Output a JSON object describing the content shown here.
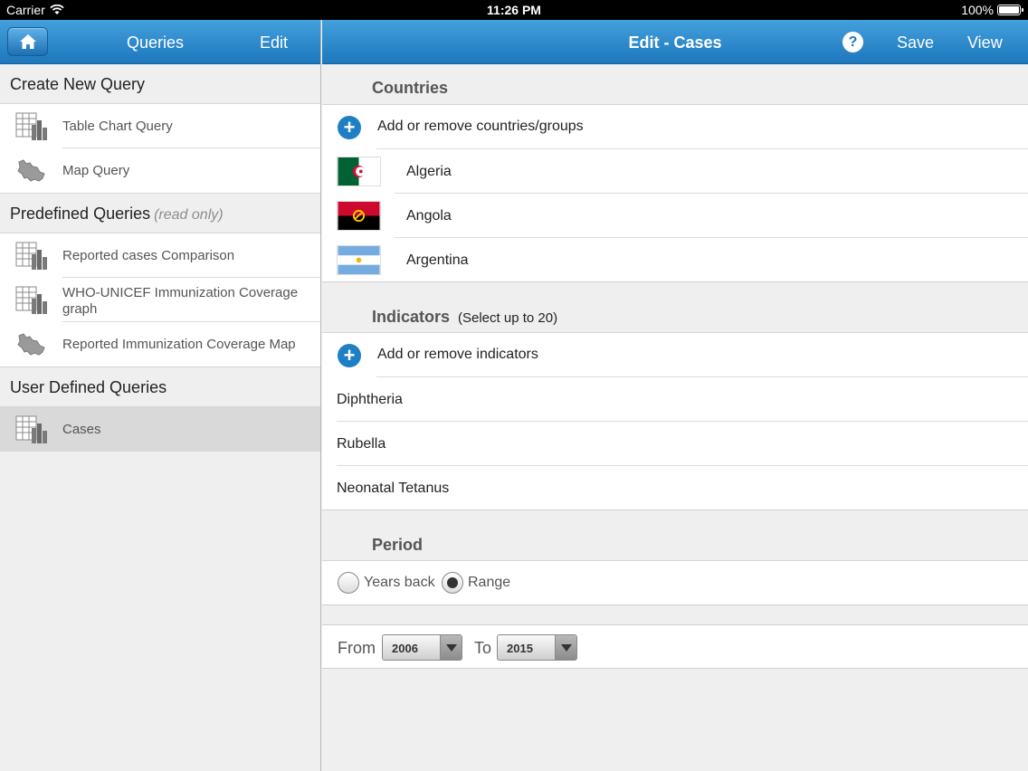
{
  "status_bar": {
    "carrier": "Carrier",
    "time": "11:26 PM",
    "battery": "100%"
  },
  "left": {
    "nav": {
      "title": "Queries",
      "edit": "Edit"
    },
    "create": {
      "title": "Create New Query",
      "items": [
        {
          "label": "Table Chart Query",
          "icon": "table-chart-icon"
        },
        {
          "label": "Map Query",
          "icon": "map-icon"
        }
      ]
    },
    "predefined": {
      "title": "Predefined Queries",
      "note": "(read only)",
      "items": [
        {
          "label": "Reported cases Comparison",
          "icon": "table-chart-icon"
        },
        {
          "label": "WHO-UNICEF Immunization Coverage graph",
          "icon": "table-chart-icon"
        },
        {
          "label": "Reported Immunization Coverage Map",
          "icon": "map-icon"
        }
      ]
    },
    "user_defined": {
      "title": "User Defined Queries",
      "items": [
        {
          "label": "Cases",
          "icon": "table-chart-icon",
          "selected": true
        }
      ]
    }
  },
  "right": {
    "nav": {
      "title": "Edit - Cases",
      "help": "?",
      "save": "Save",
      "view": "View"
    },
    "countries": {
      "title": "Countries",
      "add_label": "Add or remove countries/groups",
      "items": [
        {
          "name": "Algeria"
        },
        {
          "name": "Angola"
        },
        {
          "name": "Argentina"
        }
      ]
    },
    "indicators": {
      "title": "Indicators",
      "subtitle": "(Select up to 20)",
      "add_label": "Add or remove indicators",
      "items": [
        "Diphtheria",
        "Rubella",
        "Neonatal Tetanus"
      ]
    },
    "period": {
      "title": "Period",
      "options": [
        {
          "label": "Years back",
          "selected": false
        },
        {
          "label": "Range",
          "selected": true
        }
      ],
      "from_label": "From",
      "from_value": "2006",
      "to_label": "To",
      "to_value": "2015"
    }
  },
  "colors": {
    "nav_top": "#43a0dc",
    "nav_bottom": "#1d77bd",
    "accent": "#1f7fc4"
  }
}
